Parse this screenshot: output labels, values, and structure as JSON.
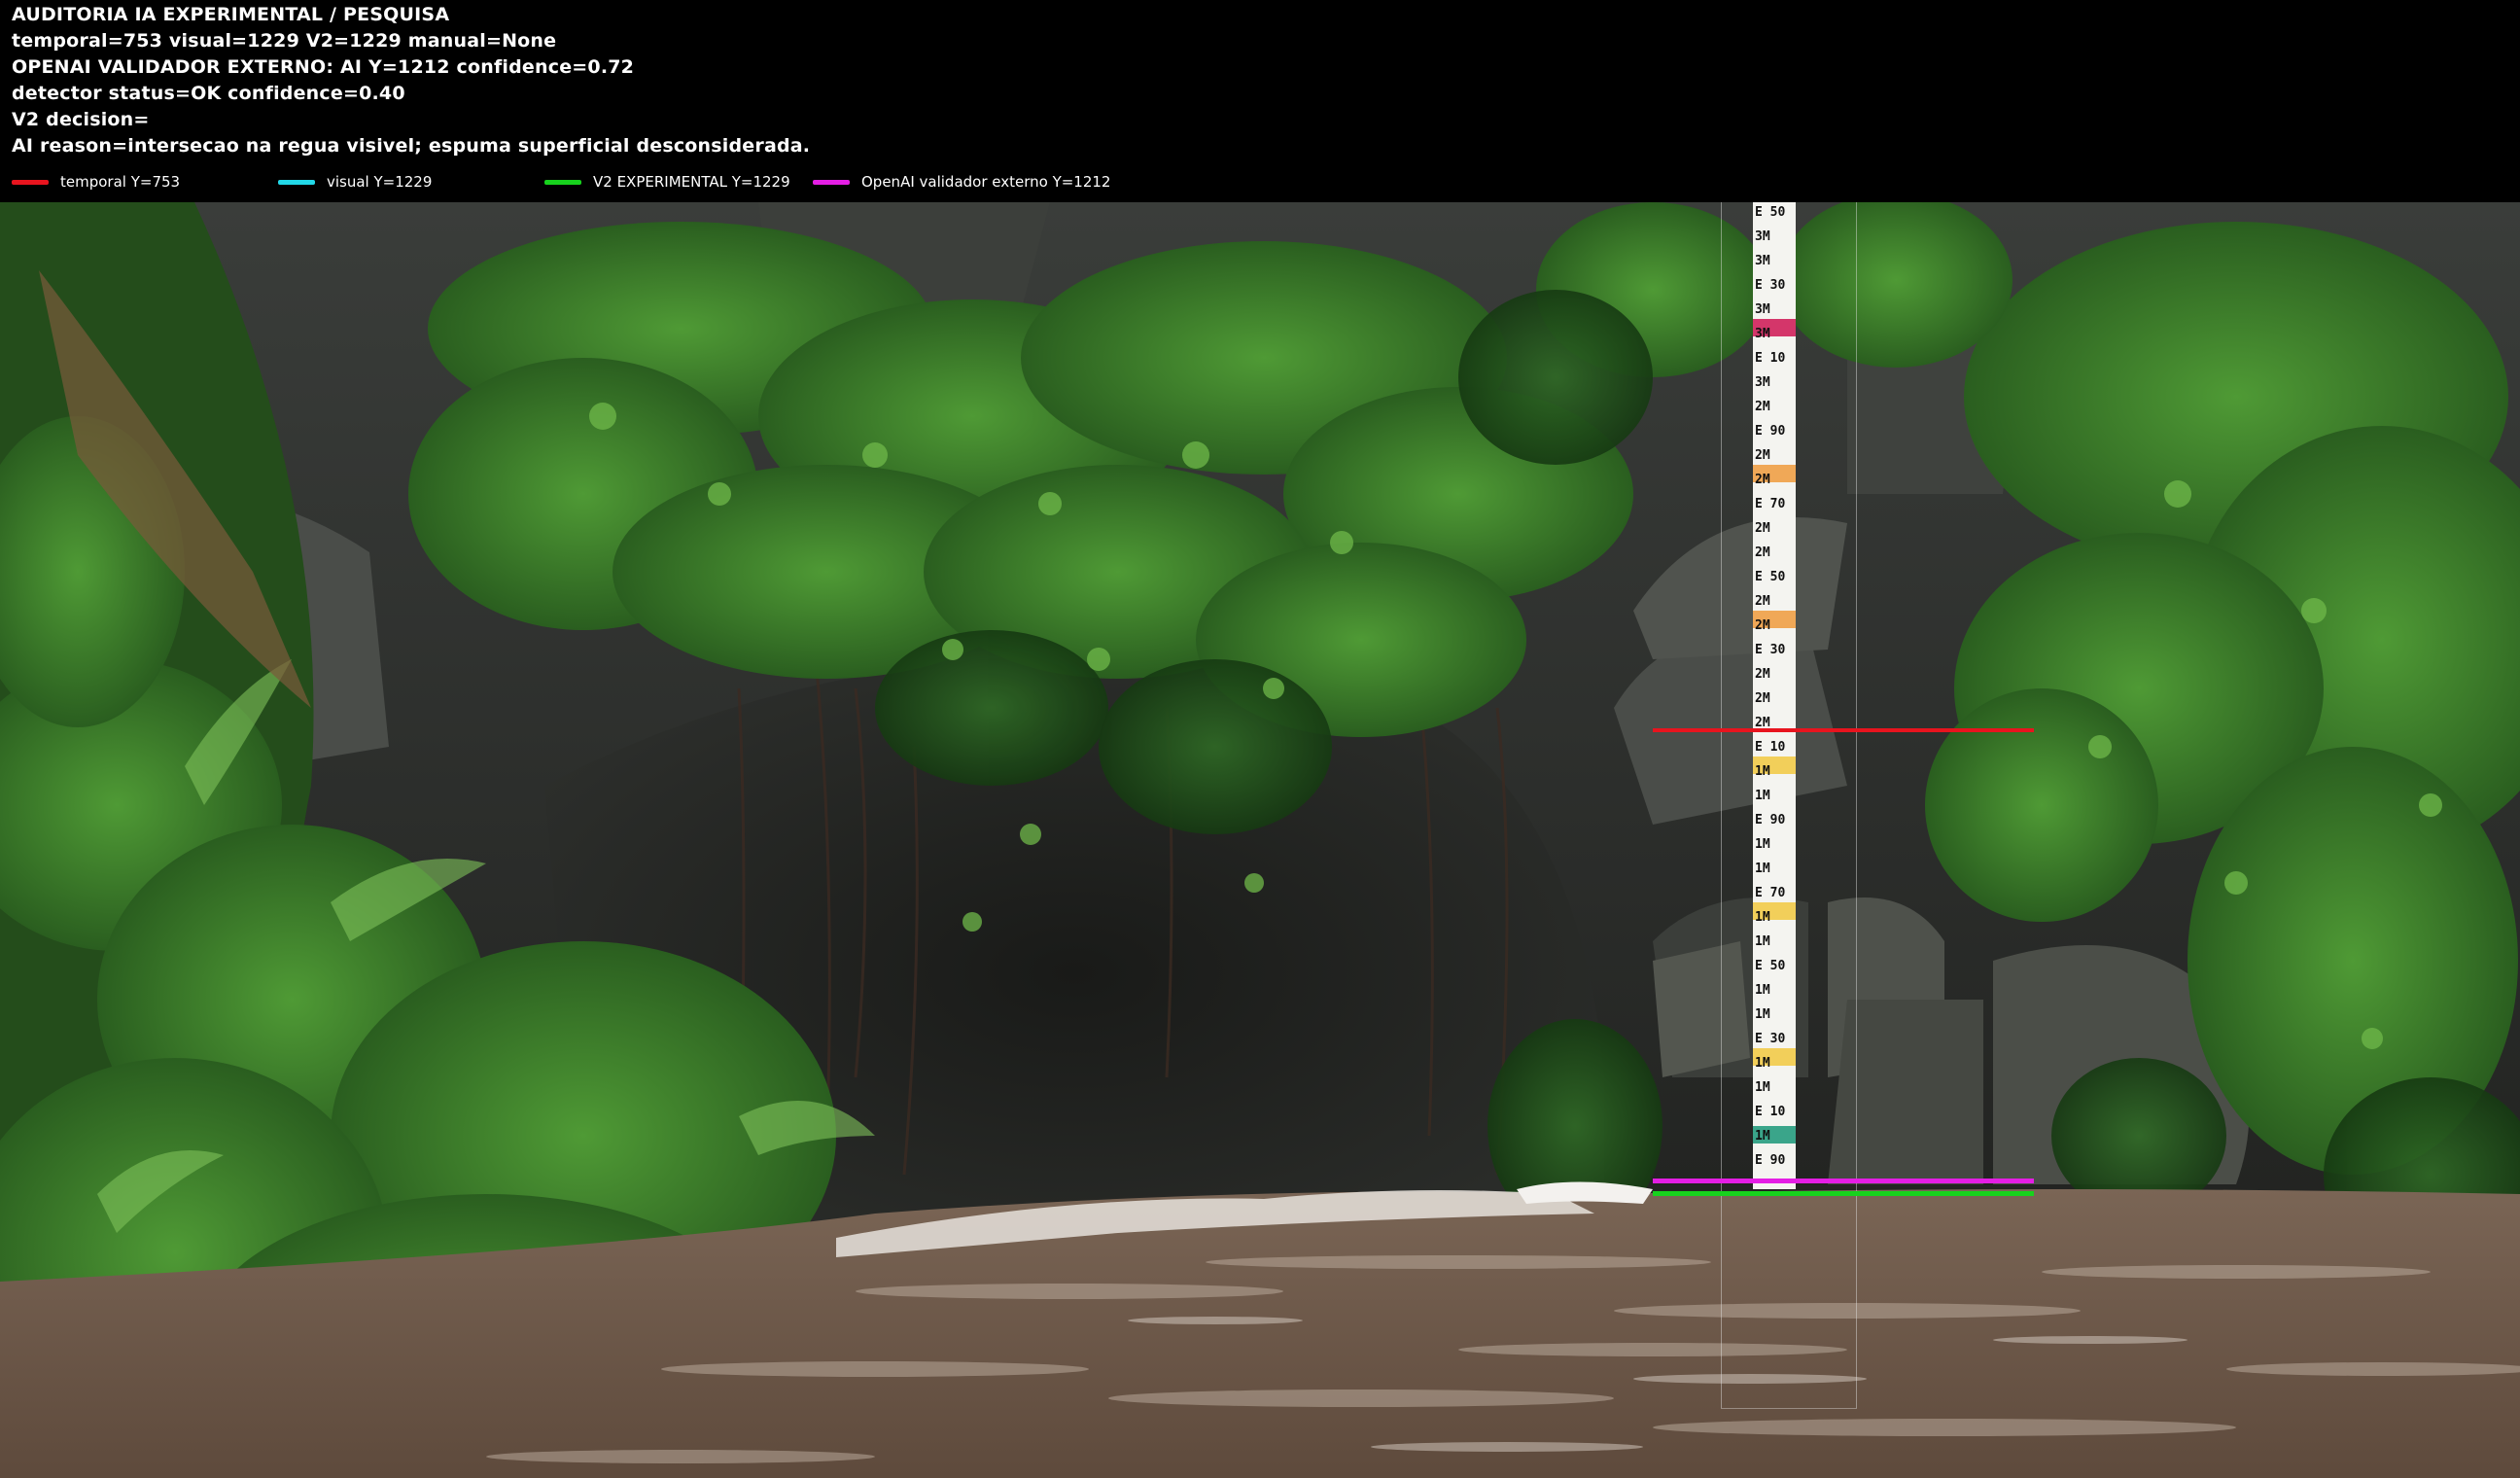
{
  "header": {
    "lines": [
      "AUDITORIA IA  EXPERIMENTAL / PESQUISA",
      "temporal=753  visual=1229  V2=1229  manual=None",
      "OPENAI  VALIDADOR EXTERNO: AI Y=1212  confidence=0.72",
      "detector status=OK confidence=0.40",
      "V2 decision=",
      "AI reason=intersecao na regua visivel; espuma superficial desconsiderada."
    ]
  },
  "legend": [
    {
      "label": "temporal Y=753",
      "color": "#e8141e"
    },
    {
      "label": "visual Y=1229",
      "color": "#22d8e8"
    },
    {
      "label": "V2 EXPERIMENTAL Y=1229",
      "color": "#17d21d"
    },
    {
      "label": "OpenAI validador externo Y=1212",
      "color": "#e41ee4"
    }
  ],
  "staff_labels": [
    "E 50",
    "3M",
    "3M",
    "E 30",
    "3M",
    "3M",
    "E 10",
    "3M",
    "2M",
    "E 90",
    "2M",
    "2M",
    "E 70",
    "2M",
    "2M",
    "E 50",
    "2M",
    "2M",
    "E 30",
    "2M",
    "2M",
    "2M",
    "E 10",
    "1M",
    "1M",
    "E 90",
    "1M",
    "1M",
    "E 70",
    "1M",
    "1M",
    "E 50",
    "1M",
    "1M",
    "E 30",
    "1M",
    "1M",
    "E 10",
    "1M",
    "E 90"
  ],
  "icons": {
    "legend_swatch": "line-swatch-icon",
    "staff": "water-level-staff-gauge"
  }
}
